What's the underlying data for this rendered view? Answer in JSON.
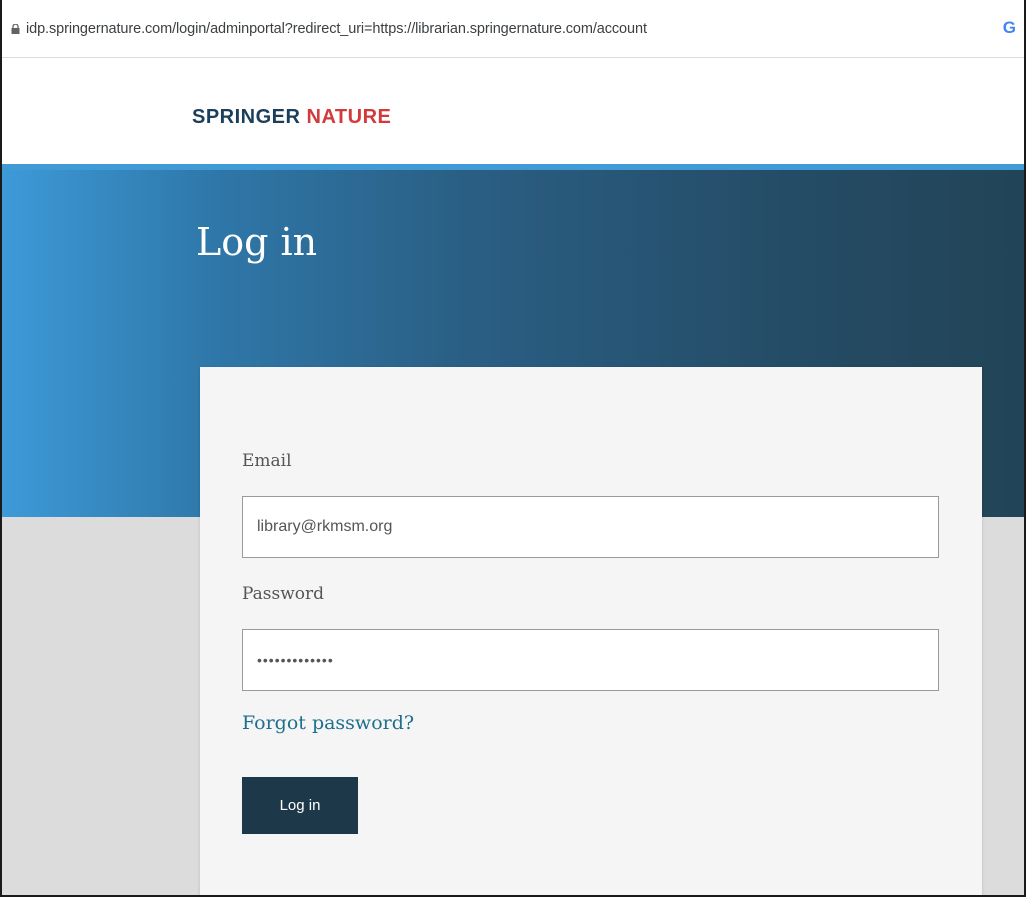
{
  "browser": {
    "url": "idp.springernature.com/login/adminportal?redirect_uri=https://librarian.springernature.com/account",
    "account_icon_label": "G"
  },
  "header": {
    "logo_part1": "SPRINGER",
    "logo_part2": "NATURE"
  },
  "hero": {
    "title": "Log in"
  },
  "form": {
    "email_label": "Email",
    "email_value": "library@rkmsm.org",
    "password_label": "Password",
    "password_value": "•••••••••••••",
    "forgot_link": "Forgot password?",
    "submit_label": "Log in"
  },
  "colors": {
    "hero_left": "#3d9ad8",
    "hero_right": "#224457",
    "button_bg": "#1d3949",
    "link": "#1d6f8c",
    "logo_blue": "#1b3f5a",
    "logo_red": "#d23b3b"
  }
}
